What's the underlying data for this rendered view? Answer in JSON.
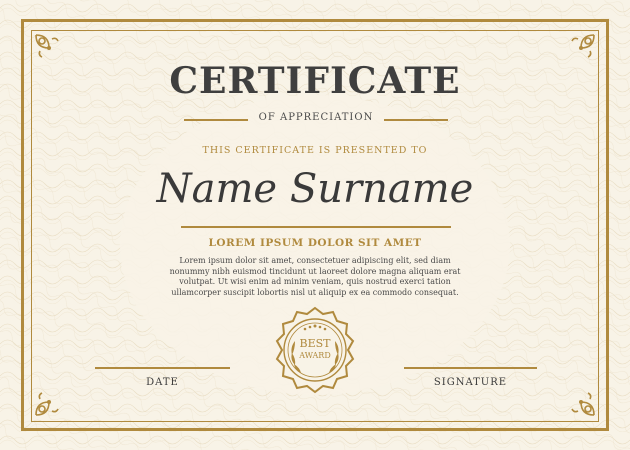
{
  "certificate": {
    "title": "CERTIFICATE",
    "subtitle": "OF APPRECIATION",
    "presented_text": "THIS CERTIFICATE IS PRESENTED TO",
    "recipient_name": "Name Surname",
    "heading": "LOREM IPSUM DOLOR SIT AMET",
    "body": "Lorem ipsum dolor sit amet, consectetuer adipiscing elit, sed diam nonummy nibh euismod tincidunt ut laoreet dolore magna aliquam erat volutpat. Ut wisi enim ad minim veniam, quis nostrud exerci tation ullamcorper suscipit lobortis nisl ut aliquip ex ea commodo consequat.",
    "seal_line1": "BEST",
    "seal_line2": "AWARD",
    "date_label": "DATE",
    "signature_label": "SIGNATURE"
  },
  "colors": {
    "background": "#f8f3e7",
    "accent_gold": "#b08a3e",
    "text_dark": "#3f3f3f"
  },
  "icons": {
    "corners": "ornament-corner-icon",
    "seal": "award-seal-icon"
  }
}
